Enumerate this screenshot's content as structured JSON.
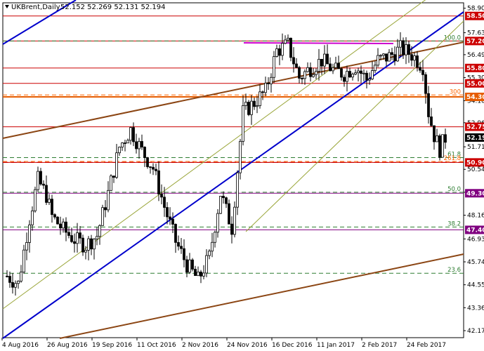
{
  "header": {
    "symbol": "UKBrent,Daily",
    "ohlc": "52.152 52.269 52.131 52.194"
  },
  "chart_data": {
    "type": "candlestick",
    "symbol": "UKBrent",
    "timeframe": "Daily",
    "ylim": [
      42.17,
      59.0
    ],
    "y_ticks": [
      {
        "v": 58.9,
        "label": "58.90"
      },
      {
        "v": 57.63,
        "label": "57.63"
      },
      {
        "v": 56.49,
        "label": "56.49"
      },
      {
        "v": 55.3,
        "label": "55.30"
      },
      {
        "v": 54.1,
        "label": "54.10"
      },
      {
        "v": 52.96,
        "label": "52.96"
      },
      {
        "v": 51.71,
        "label": "51.71"
      },
      {
        "v": 50.54,
        "label": "50.54"
      },
      {
        "v": 49.35,
        "label": "49.35"
      },
      {
        "v": 48.16,
        "label": "48.16"
      },
      {
        "v": 46.93,
        "label": "46.93"
      },
      {
        "v": 45.74,
        "label": "45.74"
      },
      {
        "v": 44.55,
        "label": "44.55"
      },
      {
        "v": 43.36,
        "label": "43.36"
      },
      {
        "v": 42.17,
        "label": "42.17"
      }
    ],
    "x_labels": [
      {
        "i": 0,
        "label": "4 Aug 2016"
      },
      {
        "i": 16,
        "label": "26 Aug 2016"
      },
      {
        "i": 32,
        "label": "19 Sep 2016"
      },
      {
        "i": 48,
        "label": "11 Oct 2016"
      },
      {
        "i": 64,
        "label": "2 Nov 2016"
      },
      {
        "i": 80,
        "label": "24 Nov 2016"
      },
      {
        "i": 96,
        "label": "16 Dec 2016"
      },
      {
        "i": 112,
        "label": "11 Jan 2017"
      },
      {
        "i": 128,
        "label": "2 Feb 2017"
      },
      {
        "i": 144,
        "label": "24 Feb 2017"
      }
    ],
    "current_price": {
      "value": 52.19,
      "label": "52.19",
      "color": "#000000"
    },
    "levels": [
      {
        "value": 58.5,
        "label": "58.50",
        "color": "#cc0000",
        "style": "solid"
      },
      {
        "value": 57.2,
        "label": "57.20",
        "color": "#cc0000",
        "style": "solid"
      },
      {
        "value": 55.8,
        "label": "55.80",
        "color": "#cc0000",
        "style": "solid"
      },
      {
        "value": 55.0,
        "label": "55.00",
        "color": "#cc0000",
        "style": "solid"
      },
      {
        "value": 54.3,
        "label": "54.30",
        "color": "#cc0000",
        "style": "solid"
      },
      {
        "value": 52.75,
        "label": "52.75",
        "color": "#cc0000",
        "style": "solid"
      },
      {
        "value": 50.9,
        "label": "50.90",
        "color": "#cc0000",
        "style": "solid"
      },
      {
        "value": 49.3,
        "label": "49.30",
        "color": "#800080",
        "style": "solid"
      },
      {
        "value": 47.4,
        "label": "47.40",
        "color": "#800080",
        "style": "solid"
      }
    ],
    "fib_levels": [
      {
        "value": 57.2,
        "label": "100.0",
        "color": "#2e7d32"
      },
      {
        "value": 51.15,
        "label": "61.8",
        "color": "#2e7d32"
      },
      {
        "value": 49.35,
        "label": "50.0",
        "color": "#2e7d32"
      },
      {
        "value": 47.55,
        "label": "38.2",
        "color": "#2e7d32"
      },
      {
        "value": 45.15,
        "label": "23.6",
        "color": "#2e7d32"
      },
      {
        "value": 54.4,
        "label": "300",
        "color": "#ff6600"
      },
      {
        "value": 50.95,
        "label": "261.8",
        "color": "#ff6600"
      }
    ],
    "colors": {
      "candle": "#000000",
      "blue_channel": "#0000cc",
      "brown_channel": "#8b4513",
      "thin_channel": "#9aa63a",
      "magenta": "#cc00cc",
      "resistance": "#cc0000",
      "support_purple": "#800080",
      "fib_green": "#2e7d32",
      "fib_orange": "#ff6600"
    },
    "bar_count": 157
  }
}
